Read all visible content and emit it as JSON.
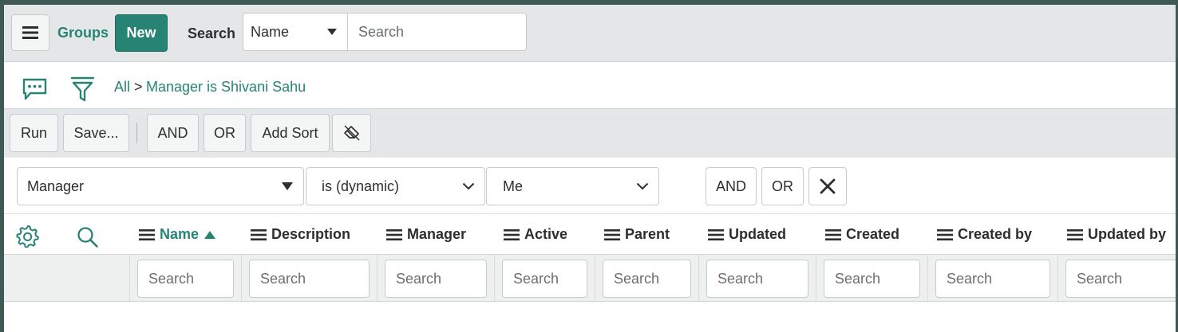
{
  "header": {
    "menu_icon": "hamburger-icon",
    "title": "Groups",
    "new_label": "New",
    "search_label": "Search",
    "search_field_select": "Name",
    "search_placeholder": "Search"
  },
  "breadcrumb": {
    "activity_icon": "chat-bubble-icon",
    "filter_icon": "funnel-icon",
    "root": "All",
    "separator": ">",
    "condition": "Manager is Shivani Sahu"
  },
  "filter_toolbar": {
    "run": "Run",
    "save": "Save...",
    "and": "AND",
    "or": "OR",
    "add_sort": "Add Sort",
    "clear_icon": "eraser-icon"
  },
  "condition": {
    "field": "Manager",
    "operator": "is (dynamic)",
    "value": "Me",
    "and": "AND",
    "or": "OR",
    "remove_icon": "close-icon"
  },
  "columns": {
    "settings_icon": "gear-icon",
    "search_icon": "magnifier-icon",
    "headers": [
      {
        "label": "Name",
        "sort": "ascending"
      },
      {
        "label": "Description"
      },
      {
        "label": "Manager"
      },
      {
        "label": "Active"
      },
      {
        "label": "Parent"
      },
      {
        "label": "Updated"
      },
      {
        "label": "Created"
      },
      {
        "label": "Created by"
      },
      {
        "label": "Updated by"
      }
    ],
    "search_placeholder": "Search"
  },
  "colors": {
    "accent": "#278474",
    "frame": "#3f5a55",
    "toolbar_bg": "#e4e6e7"
  }
}
